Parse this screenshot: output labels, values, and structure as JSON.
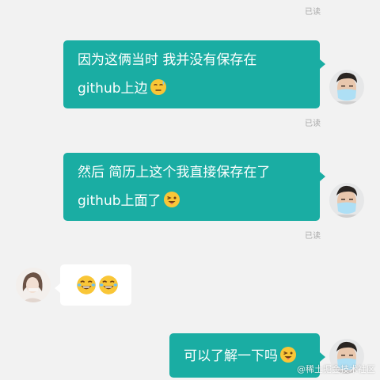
{
  "read_receipt": "已读",
  "messages": [
    {
      "lines": [
        "因为这俩当时 我并没有保存在",
        "github上边"
      ],
      "emoji": "grimace-sweat-emoji"
    },
    {
      "lines": [
        "然后  简历上这个我直接保存在了",
        "github上面了"
      ],
      "emoji": "wink-tongue-emoji"
    },
    {
      "emojis": [
        "laughing-tears-emoji",
        "laughing-tears-emoji"
      ]
    },
    {
      "lines": [
        "可以了解一下吗"
      ],
      "emoji": "wink-tongue-emoji"
    }
  ],
  "watermark": "@稀土掘金技术社区",
  "colors": {
    "outgoing_bubble": "#1aada3",
    "background": "#f2f2f2",
    "incoming_bubble": "#ffffff"
  }
}
